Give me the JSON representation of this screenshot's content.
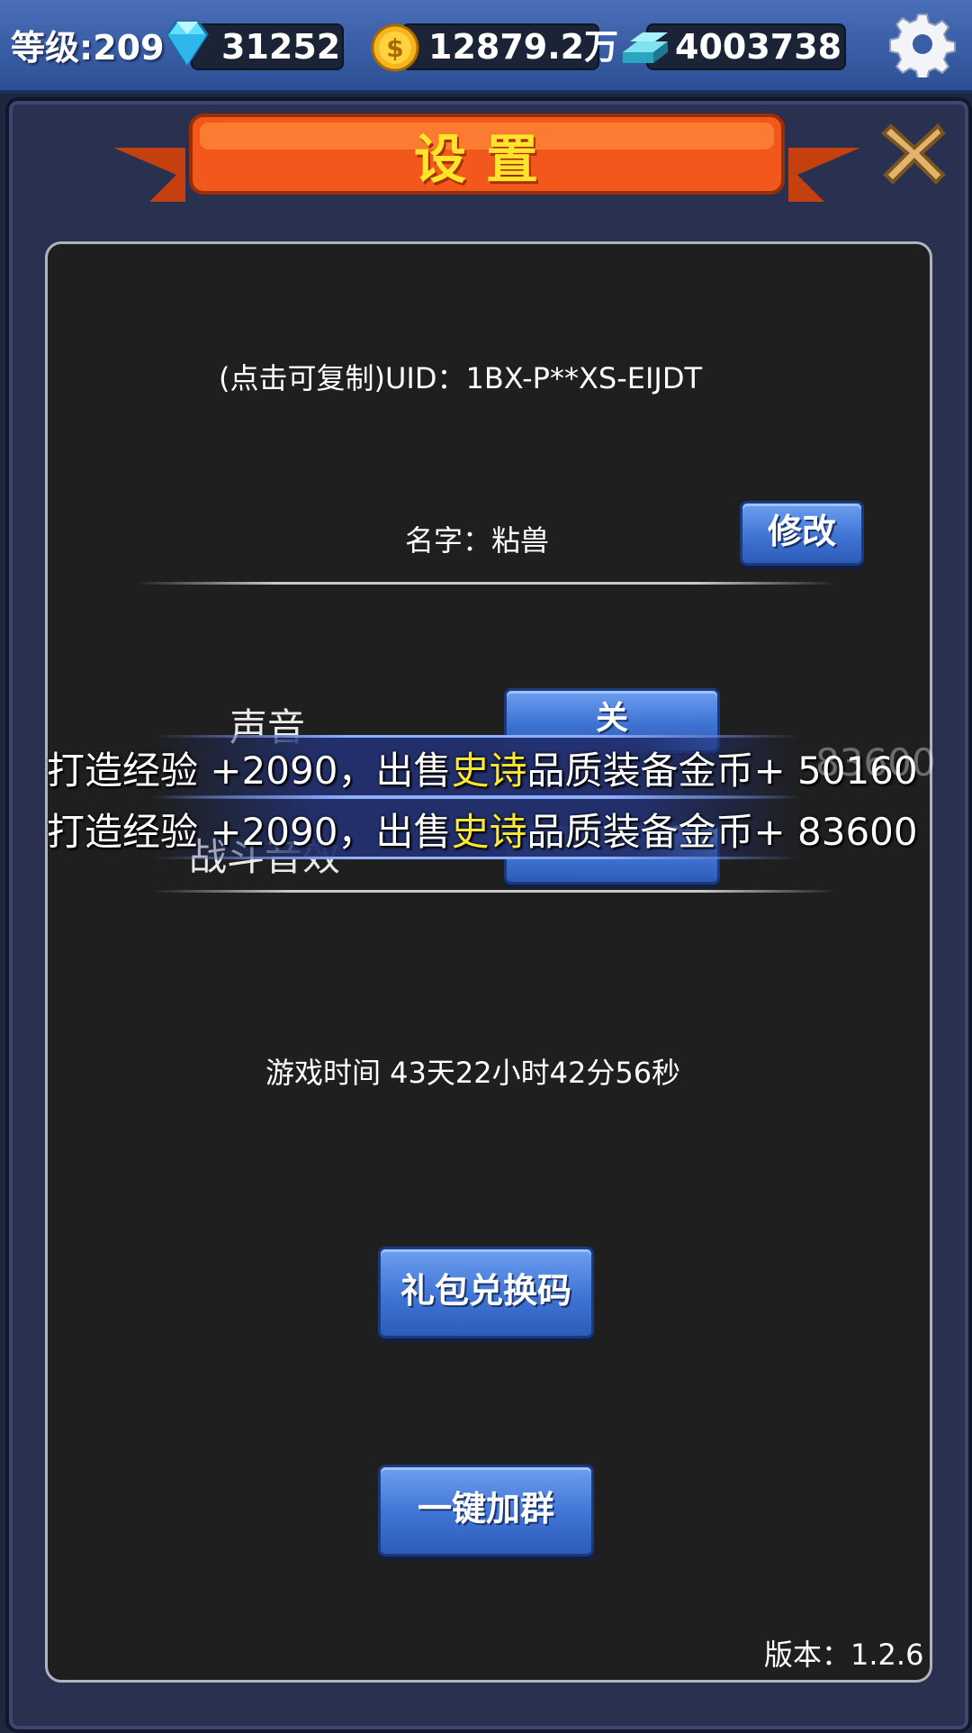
{
  "topbar": {
    "level_text": "等级:209",
    "diamonds": "31252",
    "gold": "12879.2万",
    "ingots": "4003738"
  },
  "dialog": {
    "title": "设置",
    "uid_text": "(点击可复制)UID：1BX-P**XS-EIJDT",
    "name_text": "名字：粘兽",
    "modify_label": "修改",
    "sound_label": "声音",
    "sound_toggle": "关",
    "battle_sfx_label": "战斗音效",
    "play_time": "游戏时间 43天22小时42分56秒",
    "gift_code_label": "礼包兑换码",
    "join_group_label": "一键加群",
    "version_text": "版本：1.2.6"
  },
  "notifications": [
    {
      "prefix": "打造经验 +2090，出售",
      "quality": "史诗",
      "suffix": "品质装备金币+ 50160",
      "overlay": "83600"
    },
    {
      "prefix": "打造经验 +2090，出售",
      "quality": "史诗",
      "suffix": "品质装备金币+ 83600"
    }
  ],
  "colors": {
    "highlight_quality": "#ffe82e",
    "title_yellow": "#ffe42b",
    "button_blue": "#3f74d4",
    "banner_orange": "#f2581c"
  },
  "icons": [
    "diamond-icon",
    "gold-coin-icon",
    "ingot-icon",
    "gear-icon",
    "close-icon"
  ]
}
